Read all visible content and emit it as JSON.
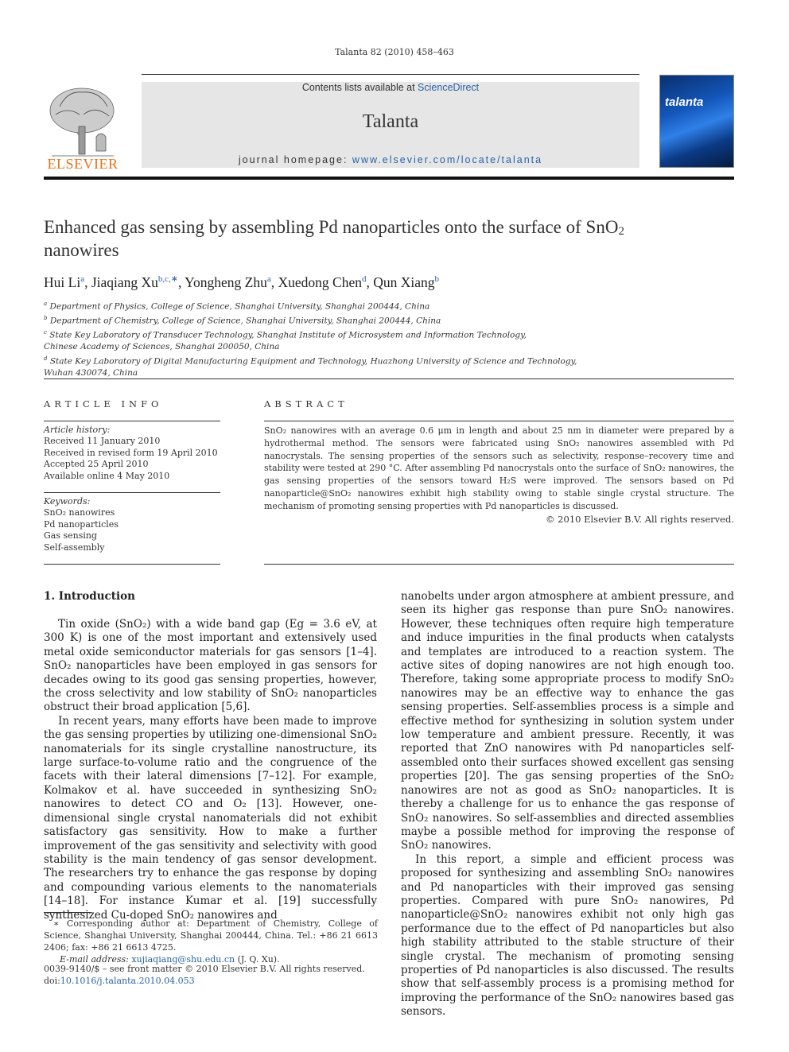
{
  "running_head": "Talanta 82 (2010) 458–463",
  "header": {
    "contents_prefix": "Contents lists available at ",
    "contents_link": "ScienceDirect",
    "journal_name": "Talanta",
    "homepage_prefix": "journal homepage: ",
    "homepage_link": "www.elsevier.com/locate/talanta",
    "publisher_logo_text": "ELSEVIER",
    "cover_title": "talanta"
  },
  "article": {
    "title_part1": "Enhanced gas sensing by assembling Pd nanoparticles onto the surface of SnO",
    "title_sub": "2",
    "title_part2": "nanowires",
    "authors": [
      {
        "name": "Hui Li",
        "aff": "a",
        "sep": ", "
      },
      {
        "name": "Jiaqiang Xu",
        "aff": "b,c,∗",
        "sep": ", "
      },
      {
        "name": "Yongheng Zhu",
        "aff": "a",
        "sep": ", "
      },
      {
        "name": "Xuedong Chen",
        "aff": "d",
        "sep": ", "
      },
      {
        "name": "Qun Xiang",
        "aff": "b",
        "sep": ""
      }
    ],
    "affiliations": [
      {
        "mark": "a",
        "text": "Department of Physics, College of Science, Shanghai University, Shanghai 200444, China"
      },
      {
        "mark": "b",
        "text": "Department of Chemistry, College of Science, Shanghai University, Shanghai 200444, China"
      },
      {
        "mark": "c",
        "text": "State Key Laboratory of Transducer Technology, Shanghai Institute of Microsystem and Information Technology,"
      },
      {
        "mark": "",
        "text": "Chinese Academy of Sciences, Shanghai 200050, China"
      },
      {
        "mark": "d",
        "text": "State Key Laboratory of Digital Manufacturing Equipment and Technology, Huazhong University of Science and Technology,"
      },
      {
        "mark": "",
        "text": "Wuhan 430074, China"
      }
    ]
  },
  "article_info": {
    "heading": "ARTICLE INFO",
    "history_label": "Article history:",
    "history": [
      "Received 11 January 2010",
      "Received in revised form 19 April 2010",
      "Accepted 25 April 2010",
      "Available online 4 May 2010"
    ],
    "keywords_label": "Keywords:",
    "keywords": [
      "SnO₂ nanowires",
      "Pd nanoparticles",
      "Gas sensing",
      "Self-assembly"
    ]
  },
  "abstract": {
    "heading": "ABSTRACT",
    "text": "SnO₂ nanowires with an average 0.6 μm in length and about 25 nm in diameter were prepared by a hydrothermal method. The sensors were fabricated using SnO₂ nanowires assembled with Pd nanocrystals. The sensing properties of the sensors such as selectivity, response–recovery time and stability were tested at 290 °C. After assembling Pd nanocrystals onto the surface of SnO₂ nanowires, the gas sensing properties of the sensors toward H₂S were improved. The sensors based on Pd nanoparticle@SnO₂ nanowires exhibit high stability owing to stable single crystal structure. The mechanism of promoting sensing properties with Pd nanoparticles is discussed.",
    "copyright": "© 2010 Elsevier B.V. All rights reserved."
  },
  "body": {
    "section_title": "1.  Introduction",
    "left_paragraphs": [
      "Tin oxide (SnO₂) with a wide band gap (Eg = 3.6 eV, at 300 K) is one of the most important and extensively used metal oxide semiconductor materials for gas sensors [1–4]. SnO₂ nanoparticles have been employed in gas sensors for decades owing to its good gas sensing properties, however, the cross selectivity and low stability of SnO₂ nanoparticles obstruct their broad application [5,6].",
      "In recent years, many efforts have been made to improve the gas sensing properties by utilizing one-dimensional SnO₂ nanomaterials for its single crystalline nanostructure, its large surface-to-volume ratio and the congruence of the facets with their lateral dimensions [7–12]. For example, Kolmakov et al. have succeeded in synthesizing SnO₂ nanowires to detect CO and O₂ [13]. However, one-dimensional single crystal nanomaterials did not exhibit satisfactory gas sensitivity. How to make a further improvement of the gas sensitivity and selectivity with good stability is the main tendency of gas sensor development. The researchers try to enhance the gas response by doping and compounding various elements to the nanomaterials [14–18]. For instance Kumar et al. [19] successfully synthesized Cu-doped SnO₂ nanowires and"
    ],
    "right_paragraphs": [
      "nanobelts under argon atmosphere at ambient pressure, and seen its higher gas response than pure SnO₂ nanowires. However, these techniques often require high temperature and induce impurities in the final products when catalysts and templates are introduced to a reaction system. The active sites of doping nanowires are not high enough too. Therefore, taking some appropriate process to modify SnO₂ nanowires may be an effective way to enhance the gas sensing properties. Self-assemblies process is a simple and effective method for synthesizing in solution system under low temperature and ambient pressure. Recently, it was reported that ZnO nanowires with Pd nanoparticles self-assembled onto their surfaces showed excellent gas sensing properties [20]. The gas sensing properties of the SnO₂ nanowires are not as good as SnO₂ nanoparticles. It is thereby a challenge for us to enhance the gas response of SnO₂ nanowires. So self-assemblies and directed assemblies maybe a possible method for improving the response of SnO₂ nanowires.",
      "In this report, a simple and efficient process was proposed for synthesizing and assembling SnO₂ nanowires and Pd nanoparticles with their improved gas sensing properties. Compared with pure SnO₂ nanowires, Pd nanoparticle@SnO₂ nanowires exhibit not only high gas performance due to the effect of Pd nanoparticles but also high stability attributed to the stable structure of their single crystal. The mechanism of promoting sensing properties of Pd nanoparticles is also discussed. The results show that self-assembly process is a promising method for improving the performance of the SnO₂ nanowires based gas sensors."
    ]
  },
  "footnote": {
    "corresponding": "∗ Corresponding author at: Department of Chemistry, College of Science, Shanghai University, Shanghai 200444, China. Tel.: +86 21 6613 2406; fax: +86 21 6613 4725.",
    "email_label": "E-mail address: ",
    "email": "xujiaqiang@shu.edu.cn",
    "email_suffix": " (J. Q. Xu)."
  },
  "front_matter": {
    "issn_line": "0039-9140/$ – see front matter © 2010 Elsevier B.V. All rights reserved.",
    "doi_prefix": "doi:",
    "doi": "10.1016/j.talanta.2010.04.053"
  }
}
